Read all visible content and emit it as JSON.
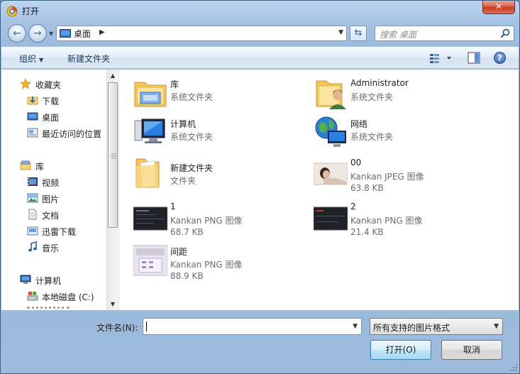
{
  "window": {
    "title": "打开"
  },
  "nav": {
    "back": "back",
    "forward": "forward"
  },
  "address": {
    "location": "桌面"
  },
  "search": {
    "placeholder": "搜索 桌面"
  },
  "toolbar": {
    "organize": "组织",
    "new_folder": "新建文件夹"
  },
  "sidebar": {
    "favorites": {
      "label": "收藏夹",
      "items": [
        {
          "label": "下载",
          "icon": "download-folder-icon"
        },
        {
          "label": "桌面",
          "icon": "desktop-icon"
        },
        {
          "label": "最近访问的位置",
          "icon": "recent-places-icon"
        }
      ]
    },
    "libraries": {
      "label": "库",
      "items": [
        {
          "label": "视频",
          "icon": "video-icon"
        },
        {
          "label": "图片",
          "icon": "picture-icon"
        },
        {
          "label": "文档",
          "icon": "document-icon"
        },
        {
          "label": "迅雷下载",
          "icon": "thunder-download-icon"
        },
        {
          "label": "音乐",
          "icon": "music-icon"
        }
      ]
    },
    "computer": {
      "label": "计算机",
      "items": [
        {
          "label": "本地磁盘 (C:)",
          "icon": "drive-icon"
        }
      ]
    }
  },
  "files": [
    {
      "name": "库",
      "type": "系统文件夹",
      "size": ""
    },
    {
      "name": "Administrator",
      "type": "系统文件夹",
      "size": ""
    },
    {
      "name": "计算机",
      "type": "系统文件夹",
      "size": ""
    },
    {
      "name": "网络",
      "type": "系统文件夹",
      "size": ""
    },
    {
      "name": "新建文件夹",
      "type": "文件夹",
      "size": ""
    },
    {
      "name": "00",
      "type": "Kankan JPEG 图像",
      "size": "63.8 KB"
    },
    {
      "name": "1",
      "type": "Kankan PNG 图像",
      "size": "68.7 KB"
    },
    {
      "name": "2",
      "type": "Kankan PNG 图像",
      "size": "21.4 KB"
    },
    {
      "name": "间距",
      "type": "Kankan PNG 图像",
      "size": "88.9 KB"
    }
  ],
  "bottom": {
    "filename_label": "文件名(N):",
    "filename_value": "",
    "filter": "所有支持的图片格式",
    "open": "打开(O)",
    "cancel": "取消"
  },
  "colors": {
    "accent": "#2b62a8",
    "close": "#c43a20"
  }
}
